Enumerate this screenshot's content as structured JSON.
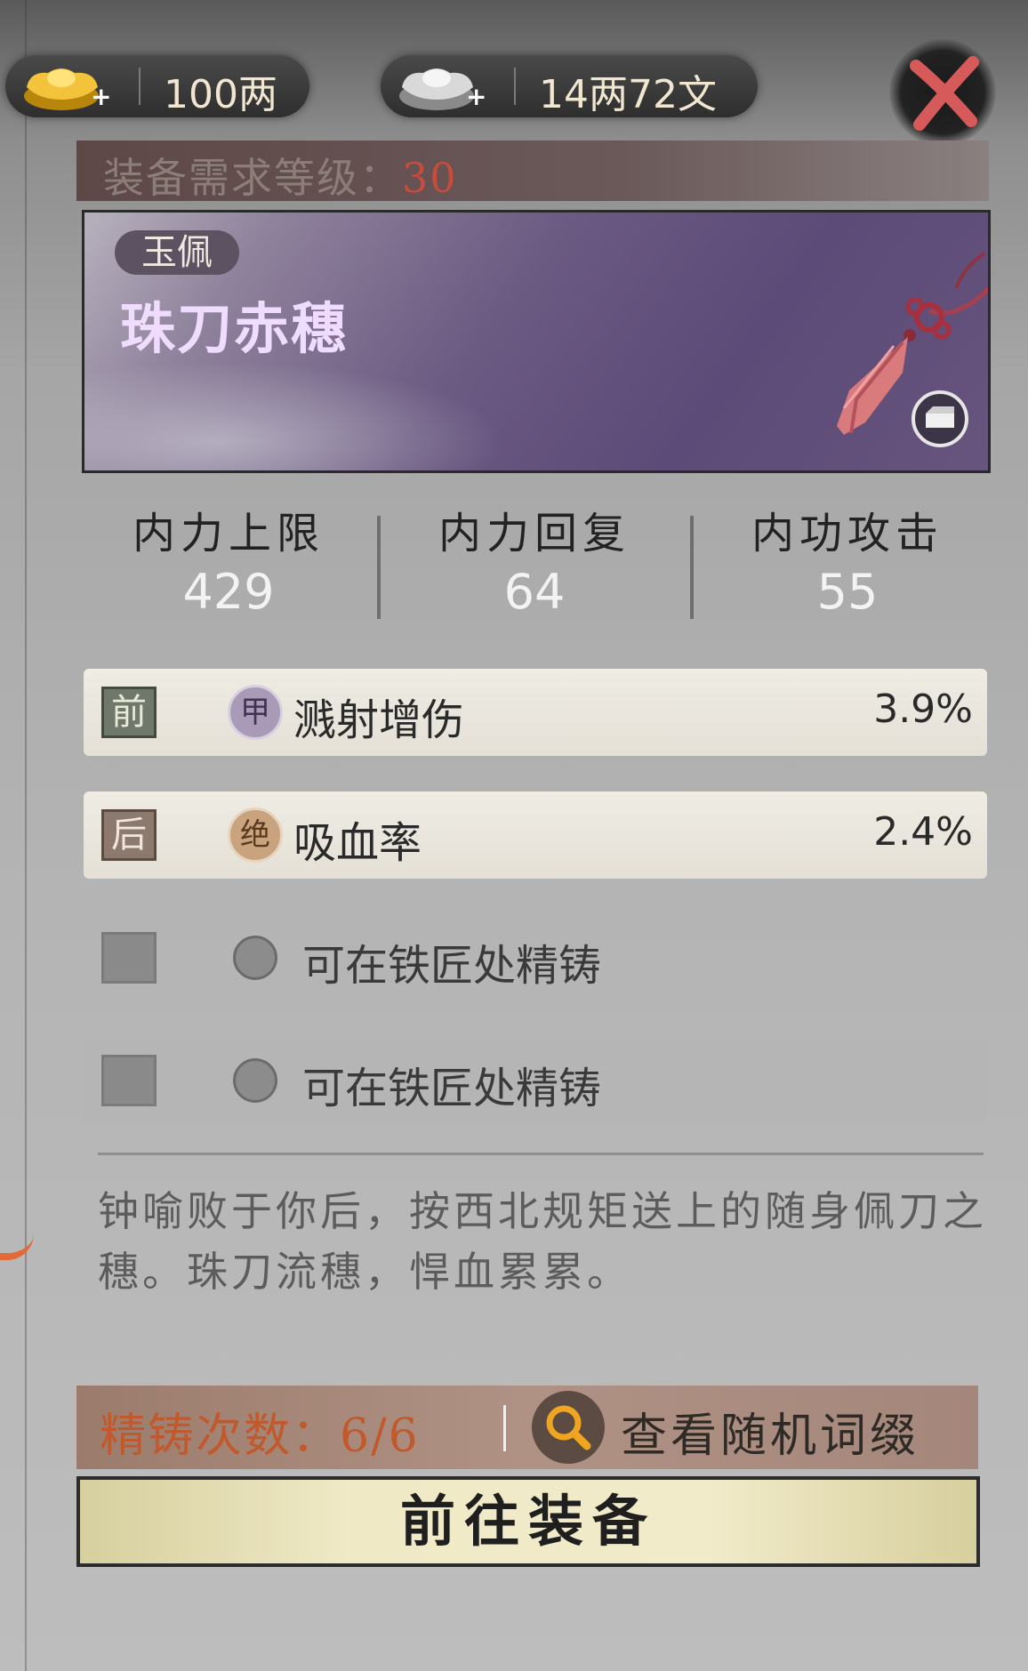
{
  "currency": {
    "gold": {
      "icon": "gold-ingot-icon",
      "value": "100两"
    },
    "silver": {
      "icon": "silver-ingot-icon",
      "value": "14两72文"
    }
  },
  "close_icon": "close-icon",
  "requirement": {
    "label": "装备需求等级：",
    "level": "30"
  },
  "item": {
    "type_tag": "玉佩",
    "name": "珠刀赤穗",
    "icon": "tassel-icon",
    "equip_badge_icon": "equip-box-icon"
  },
  "stats": [
    {
      "label": "内力上限",
      "value": "429"
    },
    {
      "label": "内力回复",
      "value": "64"
    },
    {
      "label": "内功攻击",
      "value": "55"
    }
  ],
  "affixes": [
    {
      "slot": "前",
      "grade": "甲",
      "name": "溅射增伤",
      "value": "3.9%"
    },
    {
      "slot": "后",
      "grade": "绝",
      "name": "吸血率",
      "value": "2.4%"
    },
    {
      "slot": "",
      "grade": "",
      "name": "可在铁匠处精铸",
      "value": ""
    },
    {
      "slot": "",
      "grade": "",
      "name": "可在铁匠处精铸",
      "value": ""
    }
  ],
  "description": "钟喻败于你后，按西北规矩送上的随身佩刀之穗。珠刀流穗，悍血累累。",
  "forge": {
    "label": "精铸次数：",
    "count": "6/6",
    "search_icon": "magnifier-icon",
    "search_label": "查看随机词缀"
  },
  "action_button": "前往装备",
  "colors": {
    "level_red": "#c74c3e",
    "item_purple": "#efdcff",
    "forge_orange": "#c2592c"
  }
}
